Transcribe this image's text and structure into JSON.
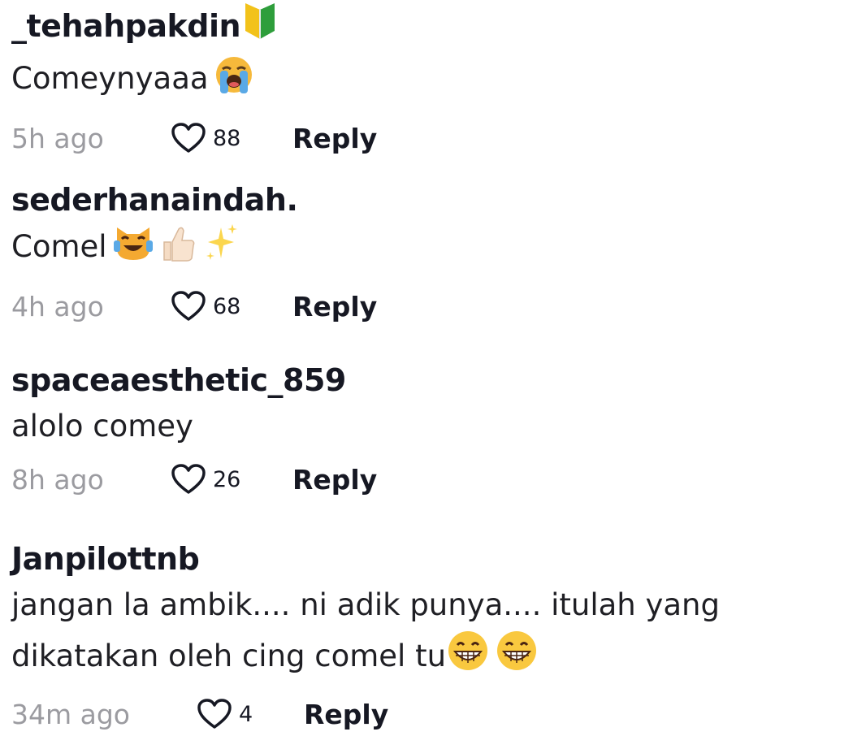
{
  "comments": [
    {
      "username": "_tehahpakdin",
      "badge_icon": "beginner-symbol-icon",
      "text": "Comeynyaaa",
      "emojis": [
        "loudly-crying-face-icon"
      ],
      "time": "5h ago",
      "likes": "88",
      "reply_label": "Reply"
    },
    {
      "username": "sederhanaindah.",
      "text": "Comel",
      "emojis": [
        "cat-tears-of-joy-icon",
        "thumbs-up-icon",
        "sparkles-icon"
      ],
      "time": "4h ago",
      "likes": "68",
      "reply_label": "Reply"
    },
    {
      "username": "spaceaesthetic_859",
      "text": "alolo comey",
      "emojis": [],
      "time": "8h ago",
      "likes": "26",
      "reply_label": "Reply"
    },
    {
      "username": "Janpilottnb",
      "text_line1": "jangan la ambik.... ni adik punya.... itulah yang",
      "text_line2": "dikatakan oleh cing comel tu",
      "emojis": [
        "grinning-face-icon",
        "grinning-face-icon"
      ],
      "time": "34m ago",
      "likes": "4",
      "reply_label": "Reply"
    }
  ],
  "colors": {
    "username": "#161823",
    "text": "#1f1f24",
    "time": "#9b9ba0"
  }
}
